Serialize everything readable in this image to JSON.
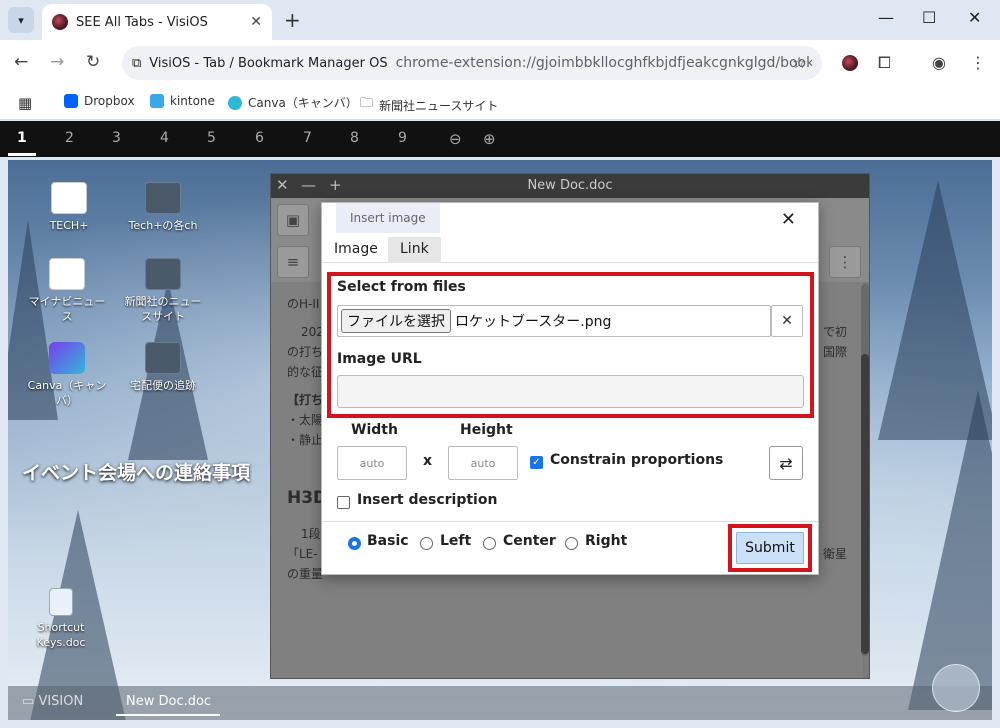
{
  "browser": {
    "tab_title": "SEE All Tabs - VisiOS",
    "omnibox_site": "VisiOS - Tab / Bookmark Manager OS",
    "omnibox_url": "chrome-extension://gjoimbbkllocghfkbjdfjeakcgnkglgd/bookma...",
    "bookmarks": [
      "Dropbox",
      "kintone",
      "Canva（キャンバ）",
      "新聞社ニュースサイト"
    ]
  },
  "workspaces": [
    "1",
    "2",
    "3",
    "4",
    "5",
    "6",
    "7",
    "8",
    "9"
  ],
  "desktop": {
    "icons": [
      {
        "label": "TECH+"
      },
      {
        "label": "Tech+の各ch"
      },
      {
        "label": "マイナビニュース"
      },
      {
        "label": "新聞社のニュースサイト"
      },
      {
        "label": "Canva（キャンバ）"
      },
      {
        "label": "宅配便の追跡"
      },
      {
        "label": "Shortcut Keys.doc"
      }
    ],
    "big_text": "イベント会場への連絡事項"
  },
  "taskbar": {
    "vision": "VISION",
    "active": "New Doc.doc"
  },
  "doc": {
    "title": "New Doc.doc",
    "lines": [
      "のH-II",
      "202",
      "の打ち",
      "的な征",
      "【打ち",
      "・太陽",
      "・静止",
      "H3D",
      "1段",
      "「LE-",
      "の重量"
    ],
    "right_lines": [
      "で初",
      "国際",
      "衛星"
    ]
  },
  "dialog": {
    "header": "Insert image",
    "tabs": [
      "Image",
      "Link"
    ],
    "select_label": "Select from files",
    "file_button": "ファイルを選択",
    "file_name": "ロケットブースター.png",
    "url_label": "Image URL",
    "width_label": "Width",
    "height_label": "Height",
    "width_placeholder": "auto",
    "height_placeholder": "auto",
    "x": "x",
    "constrain_label": "Constrain proportions",
    "description_label": "Insert description",
    "align_options": [
      "Basic",
      "Left",
      "Center",
      "Right"
    ],
    "submit": "Submit"
  }
}
